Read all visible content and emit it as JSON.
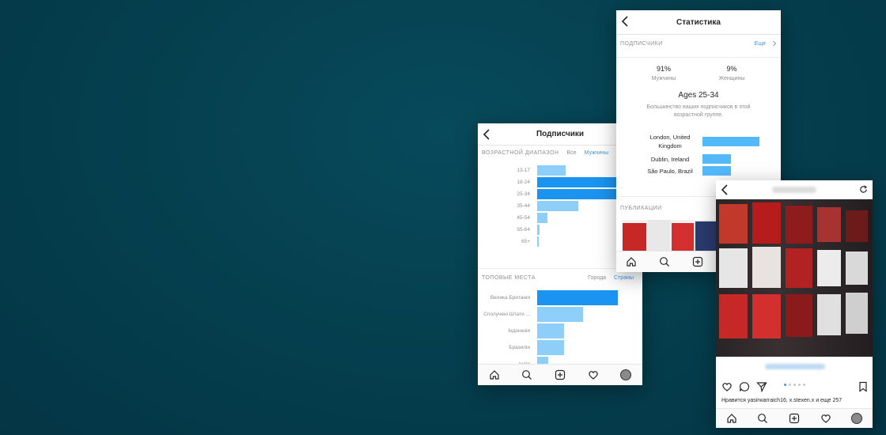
{
  "followers_screen": {
    "title": "Подписчики",
    "age_section": "ВОЗРАСТНОЙ ДИАПАЗОН",
    "tabs": [
      "Все",
      "Мужчины"
    ],
    "active_tab": "Мужчины",
    "age_groups": [
      {
        "label": "13-17",
        "value": 0.27,
        "dark": false
      },
      {
        "label": "18-24",
        "value": 0.89,
        "dark": true
      },
      {
        "label": "25-34",
        "value": 1.0,
        "dark": true
      },
      {
        "label": "35-44",
        "value": 0.39,
        "dark": false
      },
      {
        "label": "45-54",
        "value": 0.1,
        "dark": false
      },
      {
        "label": "55-64",
        "value": 0.02,
        "dark": false
      },
      {
        "label": "65+",
        "value": 0.01,
        "dark": false
      }
    ],
    "top_places_section": "ТОПОВЫЕ МЕСТА",
    "place_tabs": [
      "Города",
      "Страны"
    ],
    "active_place_tab": "Страны",
    "countries": [
      {
        "label": "Велика Британія",
        "value": 1.0,
        "dark": true
      },
      {
        "label": "Сполучені Штати ...",
        "value": 0.57,
        "dark": false
      },
      {
        "label": "Індонезія",
        "value": 0.33,
        "dark": false
      },
      {
        "label": "Бразилія",
        "value": 0.33,
        "dark": false
      },
      {
        "label": "Індія",
        "value": 0.14,
        "dark": false
      }
    ]
  },
  "stats_screen": {
    "title": "Статистика",
    "followers_section": "ПОДПИСЧИКИ",
    "more_link": "Еще",
    "male_pct": "91%",
    "male_label": "Мужчины",
    "female_pct": "9%",
    "female_label": "Женщины",
    "age_heading": "Ages 25-34",
    "age_desc": "Большинство ваших подписчиков в этой возрастной группе.",
    "locations": [
      {
        "label": "London, United Kingdom",
        "value": 1.0
      },
      {
        "label": "Dublin, Ireland",
        "value": 0.5
      },
      {
        "label": "São Paulo, Brazil",
        "value": 0.5
      }
    ],
    "publications_section": "ПУБЛИКАЦИИ"
  },
  "post_screen": {
    "likes_text": "Нравится yasirwarraich16, x.stexen.x и еще 257"
  },
  "colors": {
    "accent": "#3897f0",
    "bar_dark": "#1a94f0",
    "bar_light": "#8dcff8",
    "background": "#05404f"
  }
}
